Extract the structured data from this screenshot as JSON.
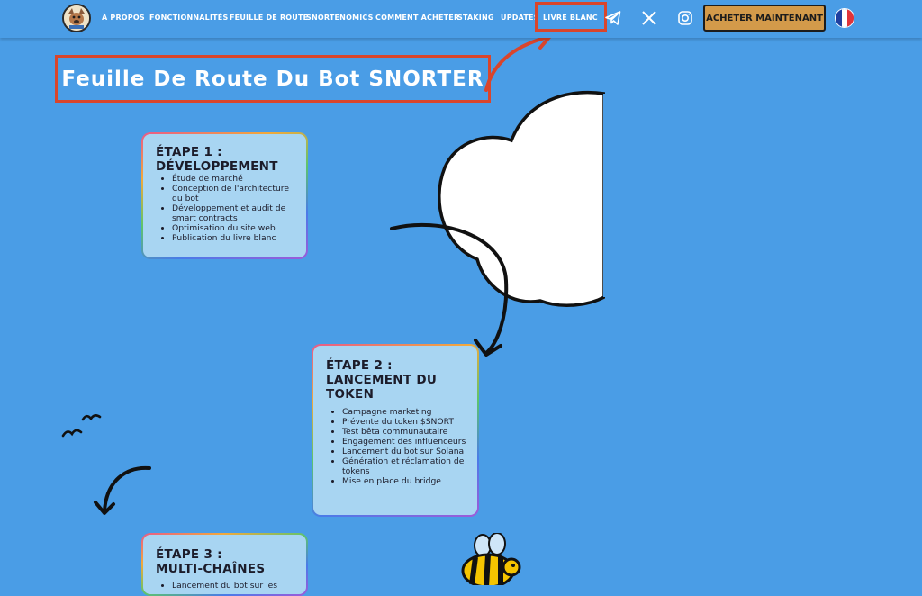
{
  "header": {
    "nav": [
      {
        "label": "À PROPOS"
      },
      {
        "label": "FONCTIONNALITÉS"
      },
      {
        "label": "FEUILLE DE ROUTE"
      },
      {
        "label": "SNORTENOMICS"
      },
      {
        "label": "COMMENT ACHETER"
      },
      {
        "label": "STAKING"
      },
      {
        "label": "UPDATES"
      },
      {
        "label": "LIVRE BLANC"
      }
    ],
    "social_icons": [
      "telegram-icon",
      "x-icon",
      "instagram-icon"
    ],
    "buy_label": "ACHETER MAINTENANT",
    "language_flag": "france-flag-icon",
    "highlight_color": "#d9452c"
  },
  "page_title": "Feuille De Route Du Bot SNORTER",
  "steps": [
    {
      "title_line1": "ÉTAPE 1 :",
      "title_line2": "DÉVELOPPEMENT",
      "items": [
        "Étude de marché",
        "Conception de l'architecture du bot",
        "Développement et audit de smart contracts",
        "Optimisation du site web",
        "Publication du livre blanc"
      ]
    },
    {
      "title_line1": "ÉTAPE 2 :",
      "title_line2": "LANCEMENT DU",
      "title_line3": "TOKEN",
      "items": [
        "Campagne marketing",
        "Prévente du token $SNORT",
        "Test bêta communautaire",
        "Engagement des influenceurs",
        "Lancement du bot sur Solana",
        "Génération et réclamation de tokens",
        "Mise en place du bridge"
      ]
    },
    {
      "title_line1": "ÉTAPE 3 :",
      "title_line2": "MULTI-CHAÎNES",
      "items": [
        "Lancement du bot sur les"
      ]
    }
  ],
  "colors": {
    "background": "#4a9de6",
    "card": "#a8d5f2",
    "button": "#d39a4a",
    "annotation": "#d9452c"
  }
}
